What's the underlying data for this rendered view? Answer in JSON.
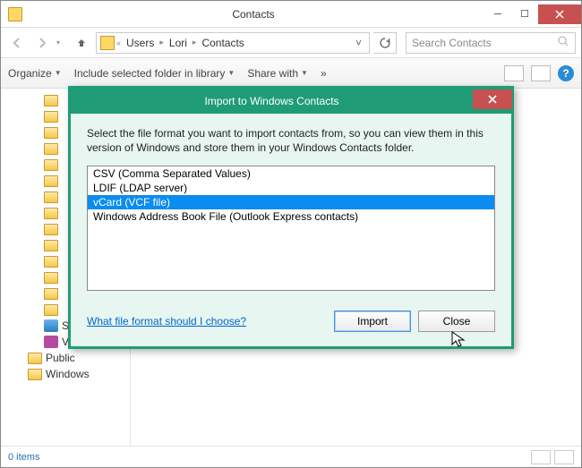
{
  "window": {
    "title": "Contacts",
    "breadcrumb": [
      "Users",
      "Lori",
      "Contacts"
    ],
    "search_placeholder": "Search Contacts"
  },
  "toolbar": {
    "organize": "Organize",
    "include": "Include selected folder in library",
    "share": "Share with",
    "more": "»"
  },
  "tree": {
    "items": [
      {
        "label": "SkyDrive",
        "kind": "skydrive"
      },
      {
        "label": "Videos",
        "kind": "videos"
      },
      {
        "label": "Public",
        "kind": "folder"
      },
      {
        "label": "Windows",
        "kind": "folder"
      }
    ],
    "folder_fill_count": 14
  },
  "statusbar": {
    "items_text": "0 items"
  },
  "dialog": {
    "title": "Import to Windows Contacts",
    "description": "Select the file format you want to import contacts from, so you can view them in this version of Windows and store them in your Windows Contacts folder.",
    "options": [
      "CSV (Comma Separated Values)",
      "LDIF (LDAP server)",
      "vCard (VCF file)",
      "Windows Address Book File (Outlook Express contacts)"
    ],
    "selected_index": 2,
    "help_link": "What file format should I choose?",
    "import_btn": "Import",
    "close_btn": "Close"
  }
}
